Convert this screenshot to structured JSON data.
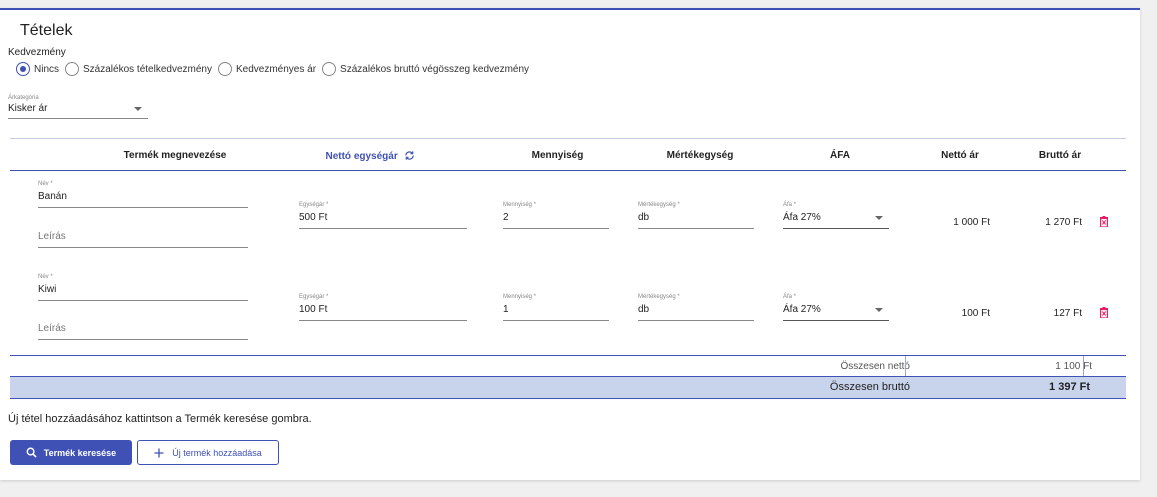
{
  "section": {
    "title": "Tételek"
  },
  "discount": {
    "label": "Kedvezmény",
    "options": [
      "Nincs",
      "Százalékos tételkedvezmény",
      "Kedvezményes ár",
      "Százalékos bruttó végösszeg kedvezmény"
    ],
    "selected": "Nincs"
  },
  "price_category": {
    "label": "Árkategória",
    "value": "Kisker ár"
  },
  "table": {
    "headers": {
      "product": "Termék megnevezése",
      "unit_price": "Nettó egységár",
      "quantity": "Mennyiség",
      "unit": "Mértékegység",
      "vat": "ÁFA",
      "net": "Nettó ár",
      "gross": "Bruttó ár"
    },
    "field_labels": {
      "name": "Név *",
      "description": "Leírás",
      "unit_price": "Egységár *",
      "quantity": "Mennyiség *",
      "unit": "Mértékegység *",
      "vat": "Áfa *"
    },
    "rows": [
      {
        "name": "Banán",
        "unit_price": "500 Ft",
        "quantity": "2",
        "unit": "db",
        "vat": "Áfa 27%",
        "net": "1 000 Ft",
        "gross": "1 270 Ft"
      },
      {
        "name": "Kiwi",
        "unit_price": "100 Ft",
        "quantity": "1",
        "unit": "db",
        "vat": "Áfa 27%",
        "net": "100 Ft",
        "gross": "127 Ft"
      }
    ],
    "totals": {
      "net_label": "Összesen nettó",
      "net_value": "1 100 Ft",
      "gross_label": "Összesen bruttó",
      "gross_value": "1 397 Ft"
    }
  },
  "hint": "Új tétel hozzáadásához kattintson a Termék keresése gombra.",
  "buttons": {
    "search": "Termék keresése",
    "add_new": "Új termék hozzáadása"
  },
  "colors": {
    "primary": "#3f51b5",
    "delete": "#e91e63",
    "totals_bg": "#c8d3ec"
  },
  "icons": {
    "refresh": "refresh-icon",
    "search": "search-icon",
    "plus": "plus-icon",
    "delete": "trash-icon",
    "dropdown": "chevron-down-icon"
  }
}
